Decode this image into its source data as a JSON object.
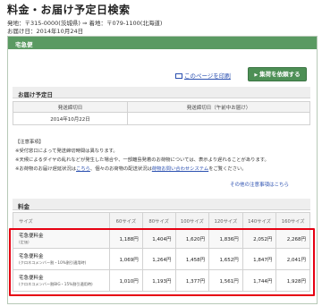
{
  "page": {
    "title": "料金・お届け予定日検索",
    "origin_label": "発地：〒315-0000(茨城県)",
    "arrow": "⇒",
    "destination_label": "着地：〒079-1100(北海道)",
    "date_label": "お届け日：2014年10月24日"
  },
  "service": {
    "name": "宅急便",
    "print_link": "このページを印刷",
    "pickup_button": "集荷を依頼する"
  },
  "delivery": {
    "section_title": "お届け予定日",
    "headers": [
      "発送締切日",
      "発送締切日（午前中お届け）"
    ],
    "values": [
      "2014年10月22日",
      ""
    ]
  },
  "notes": {
    "title": "【注意事項】",
    "lines": [
      "※受付窓口によって発送締切時間は異なります。",
      "※天候によるダイヤの乱れなどが発生した場合や、一部離島発着のお荷物については、表示より遅れることがあります。",
      "※お荷物のお届け遅延状況は",
      "、個々のお荷物の配送状況は",
      "をご覧ください。"
    ],
    "link_here": "こちら",
    "link_tracking": "荷物お問い合わせシステム",
    "other_link": "その他の注意事項はこちら"
  },
  "pricing": {
    "section_title": "料金",
    "size_header": "サイズ",
    "sizes": [
      "60サイズ",
      "80サイズ",
      "100サイズ",
      "120サイズ",
      "140サイズ",
      "160サイズ"
    ],
    "rows": [
      {
        "name": "宅急便料金",
        "sub": "(定価)",
        "values": [
          "1,188円",
          "1,404円",
          "1,620円",
          "1,836円",
          "2,052円",
          "2,268円"
        ]
      },
      {
        "name": "宅急便料金",
        "sub": "(クロネコメンバー割・10%割引適用時)",
        "values": [
          "1,069円",
          "1,264円",
          "1,458円",
          "1,652円",
          "1,847円",
          "2,041円"
        ]
      },
      {
        "name": "宅急便料金",
        "sub": "(クロネコメンバー割BIG・15%割引適用時)",
        "values": [
          "1,010円",
          "1,193円",
          "1,377円",
          "1,561円",
          "1,744円",
          "1,928円"
        ]
      }
    ]
  },
  "colors": {
    "accent_green": "#5a9a62",
    "highlight_red": "#e60012",
    "link_blue": "#2a4fb0"
  }
}
